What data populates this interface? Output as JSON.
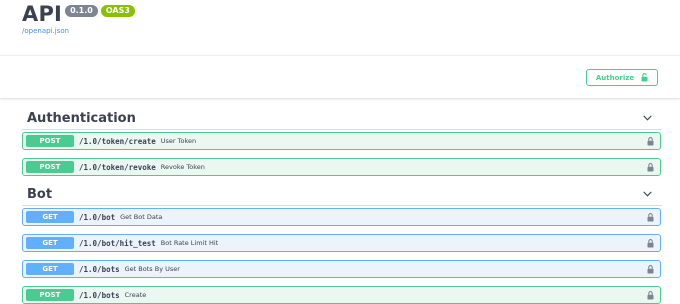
{
  "info": {
    "title": "API",
    "version": "0.1.0",
    "oas": "OAS3",
    "spec_link": "/openapi.json"
  },
  "authorize": {
    "label": "Authorize"
  },
  "sections": [
    {
      "title": "Authentication",
      "operations": [
        {
          "method": "POST",
          "path": "/1.0/token/create",
          "summary": "User Token"
        },
        {
          "method": "POST",
          "path": "/1.0/token/revoke",
          "summary": "Revoke Token"
        }
      ]
    },
    {
      "title": "Bot",
      "operations": [
        {
          "method": "GET",
          "path": "/1.0/bot",
          "summary": "Get Bot Data"
        },
        {
          "method": "GET",
          "path": "/1.0/bot/hit_test",
          "summary": "Bot Rate Limit Hit"
        },
        {
          "method": "GET",
          "path": "/1.0/bots",
          "summary": "Get Bots By User"
        },
        {
          "method": "POST",
          "path": "/1.0/bots",
          "summary": "Create"
        }
      ]
    }
  ],
  "colors": {
    "post": "#49cc90",
    "get": "#61affe",
    "link": "#4990e2"
  }
}
